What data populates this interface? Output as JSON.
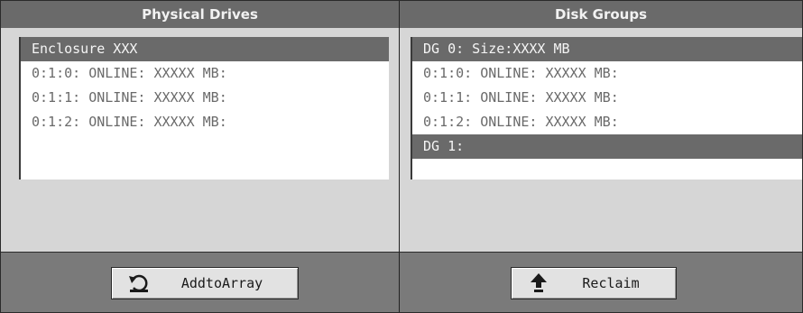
{
  "physical_drives": {
    "title": "Physical Drives",
    "items": [
      {
        "label": "Enclosure XXX",
        "selected": true
      },
      {
        "label": "0:1:0: ONLINE: XXXXX MB:",
        "selected": false
      },
      {
        "label": "0:1:1: ONLINE: XXXXX MB:",
        "selected": false
      },
      {
        "label": "0:1:2: ONLINE: XXXXX MB:",
        "selected": false
      }
    ],
    "button_label": "AddtoArray",
    "button_icon": "add-to-array-icon"
  },
  "disk_groups": {
    "title": "Disk Groups",
    "items": [
      {
        "label": "DG 0: Size:XXXX MB",
        "selected": true
      },
      {
        "label": "0:1:0: ONLINE: XXXXX MB:",
        "selected": false
      },
      {
        "label": "0:1:1: ONLINE: XXXXX MB:",
        "selected": false
      },
      {
        "label": "0:1:2: ONLINE: XXXXX MB:",
        "selected": false
      },
      {
        "label": "DG 1:",
        "selected": true
      }
    ],
    "button_label": "Reclaim",
    "button_icon": "up-arrow-icon"
  }
}
